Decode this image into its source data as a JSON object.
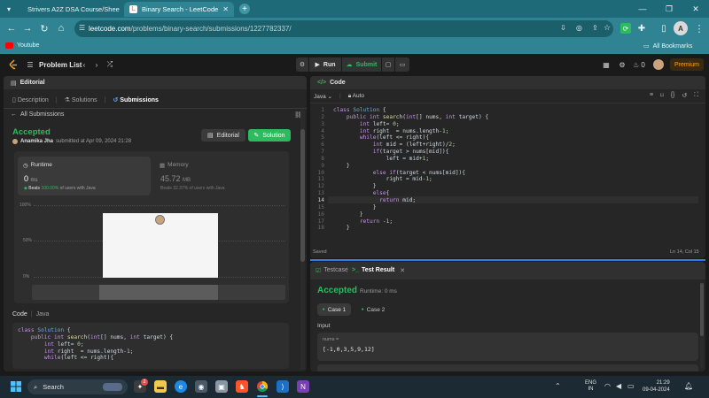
{
  "browser": {
    "tabs": [
      {
        "label": "Strivers A2Z DSA Course/Shee",
        "active": false
      },
      {
        "label": "Binary Search - LeetCode",
        "active": true
      }
    ],
    "url_host": "leetcode.com",
    "url_path": "/problems/binary-search/submissions/1227782337/",
    "bookmarks": [
      {
        "label": "Youtube"
      }
    ],
    "all_bookmarks": "All Bookmarks",
    "profile_initial": "A"
  },
  "lc_header": {
    "problem_list": "Problem List",
    "run": "Run",
    "submit": "Submit",
    "streak": "0",
    "premium": "Premium"
  },
  "left_panel": {
    "title": "Editorial",
    "subtabs": [
      "Description",
      "Solutions",
      "Submissions"
    ],
    "back_label": "All Submissions",
    "status": "Accepted",
    "author": "Anamika Jha",
    "submitted": "submitted at Apr 09, 2024 21:28",
    "editorial_btn": "Editorial",
    "solution_btn": "Solution",
    "runtime": {
      "label": "Runtime",
      "value": "0",
      "unit": "ms",
      "beats_prefix": "Beats",
      "beats_value": "100.00%",
      "beats_suffix": "of users with Java"
    },
    "memory": {
      "label": "Memory",
      "value": "45.72",
      "unit": "MB",
      "beats_prefix": "Beats",
      "beats_value": "32.37%",
      "beats_suffix": "of users with Java"
    },
    "chart_ticks": [
      "100%",
      "50%",
      "0%"
    ],
    "code_label": "Code",
    "code_lang": "Java",
    "code_lines": [
      [
        {
          "c": "kw",
          "t": "class "
        },
        {
          "c": "ty",
          "t": "Solution"
        },
        {
          "c": "pl",
          "t": " {"
        }
      ],
      [
        {
          "c": "pl",
          "t": "    "
        },
        {
          "c": "kw",
          "t": "public int "
        },
        {
          "c": "fn",
          "t": "search"
        },
        {
          "c": "pl",
          "t": "("
        },
        {
          "c": "kw",
          "t": "int"
        },
        {
          "c": "pl",
          "t": "[] nums, "
        },
        {
          "c": "kw",
          "t": "int"
        },
        {
          "c": "pl",
          "t": " target) {"
        }
      ],
      [
        {
          "c": "pl",
          "t": "        "
        },
        {
          "c": "kw",
          "t": "int"
        },
        {
          "c": "pl",
          "t": " left= "
        },
        {
          "c": "nm",
          "t": "0"
        },
        {
          "c": "pl",
          "t": ";"
        }
      ],
      [
        {
          "c": "pl",
          "t": "        "
        },
        {
          "c": "kw",
          "t": "int"
        },
        {
          "c": "pl",
          "t": " right  = nums.length-"
        },
        {
          "c": "nm",
          "t": "1"
        },
        {
          "c": "pl",
          "t": ";"
        }
      ],
      [
        {
          "c": "pl",
          "t": "        "
        },
        {
          "c": "kw",
          "t": "while"
        },
        {
          "c": "pl",
          "t": "(left <= right){"
        }
      ]
    ]
  },
  "right_panel": {
    "title": "Code",
    "language": "Java",
    "mode": "Auto",
    "code_lines": [
      [
        {
          "c": "kw",
          "t": "class "
        },
        {
          "c": "ty",
          "t": "Solution"
        },
        {
          "c": "pl",
          "t": " {"
        }
      ],
      [
        {
          "c": "pl",
          "t": "    "
        },
        {
          "c": "kw",
          "t": "public int "
        },
        {
          "c": "fn",
          "t": "search"
        },
        {
          "c": "pl",
          "t": "("
        },
        {
          "c": "kw",
          "t": "int"
        },
        {
          "c": "pl",
          "t": "[] nums, "
        },
        {
          "c": "kw",
          "t": "int"
        },
        {
          "c": "pl",
          "t": " target) {"
        }
      ],
      [
        {
          "c": "pl",
          "t": "        "
        },
        {
          "c": "kw",
          "t": "int"
        },
        {
          "c": "pl",
          "t": " left= "
        },
        {
          "c": "nm",
          "t": "0"
        },
        {
          "c": "pl",
          "t": ";"
        }
      ],
      [
        {
          "c": "pl",
          "t": "        "
        },
        {
          "c": "kw",
          "t": "int"
        },
        {
          "c": "pl",
          "t": " right  = nums.length-"
        },
        {
          "c": "nm",
          "t": "1"
        },
        {
          "c": "pl",
          "t": ";"
        }
      ],
      [
        {
          "c": "pl",
          "t": "        "
        },
        {
          "c": "kw",
          "t": "while"
        },
        {
          "c": "pl",
          "t": "(left <= right){"
        }
      ],
      [
        {
          "c": "pl",
          "t": "            "
        },
        {
          "c": "kw",
          "t": "int"
        },
        {
          "c": "pl",
          "t": " mid = (left+right)/"
        },
        {
          "c": "nm",
          "t": "2"
        },
        {
          "c": "pl",
          "t": ";"
        }
      ],
      [
        {
          "c": "pl",
          "t": "            "
        },
        {
          "c": "kw",
          "t": "if"
        },
        {
          "c": "pl",
          "t": "(target > nums[mid]){"
        }
      ],
      [
        {
          "c": "pl",
          "t": "                left = mid+"
        },
        {
          "c": "nm",
          "t": "1"
        },
        {
          "c": "pl",
          "t": ";"
        }
      ],
      [
        {
          "c": "pl",
          "t": "    }"
        }
      ],
      [
        {
          "c": "pl",
          "t": "            "
        },
        {
          "c": "kw",
          "t": "else if"
        },
        {
          "c": "pl",
          "t": "(target < nums[mid]){"
        }
      ],
      [
        {
          "c": "pl",
          "t": "                right = mid-"
        },
        {
          "c": "nm",
          "t": "1"
        },
        {
          "c": "pl",
          "t": ";"
        }
      ],
      [
        {
          "c": "pl",
          "t": "            }"
        }
      ],
      [
        {
          "c": "pl",
          "t": "            "
        },
        {
          "c": "kw",
          "t": "else"
        },
        {
          "c": "pl",
          "t": "{"
        }
      ],
      [
        {
          "c": "pl",
          "t": "              "
        },
        {
          "c": "kw",
          "t": "return"
        },
        {
          "c": "pl",
          "t": " mid;"
        }
      ],
      [
        {
          "c": "pl",
          "t": "            }"
        }
      ],
      [
        {
          "c": "pl",
          "t": "        }"
        }
      ],
      [
        {
          "c": "pl",
          "t": "        "
        },
        {
          "c": "kw",
          "t": "return"
        },
        {
          "c": "pl",
          "t": " -"
        },
        {
          "c": "nm",
          "t": "1"
        },
        {
          "c": "pl",
          "t": ";"
        }
      ],
      [
        {
          "c": "pl",
          "t": "    }"
        }
      ]
    ],
    "saved": "Saved",
    "cursor": "Ln 14, Col 15"
  },
  "result_panel": {
    "tab_testcase": "Testcase",
    "tab_result": "Test Result",
    "status": "Accepted",
    "runtime": "Runtime: 0 ms",
    "cases": [
      "Case 1",
      "Case 2"
    ],
    "input_label": "Input",
    "param_name": "nums =",
    "param_value": "[-1,0,3,5,9,12]"
  },
  "taskbar": {
    "search": "Search",
    "lang_top": "ENG",
    "lang_bottom": "IN",
    "time": "21:29",
    "date": "09-04-2024",
    "badge": "2"
  },
  "colors": {
    "accent_green": "#2cbb5d",
    "premium": "#ffa116",
    "chrome_teal": "#2f8392"
  }
}
